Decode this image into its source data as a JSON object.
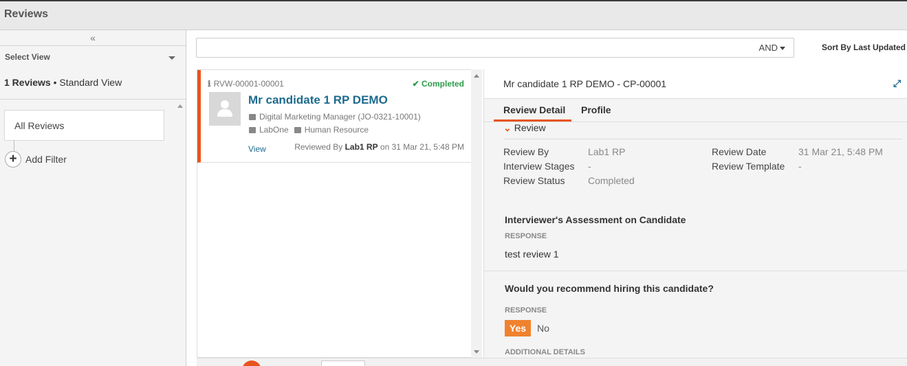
{
  "app": {
    "title": "Reviews"
  },
  "sidebar": {
    "collapse_glyph": "«",
    "select_view_label": "Select View",
    "review_count": "1 Reviews",
    "view_name": "• Standard View",
    "saved_view": "All Reviews",
    "add_filter_label": "Add Filter"
  },
  "search": {
    "value": "",
    "operator": "AND"
  },
  "sort": {
    "label": "Sort By Last Updated"
  },
  "review_card": {
    "id": "RVW-00001-00001",
    "status": "✔ Completed",
    "candidate_name": "Mr candidate 1 RP DEMO",
    "job": "Digital Marketing Manager (JO-0321-10001)",
    "company": "LabOne",
    "department": "Human Resource",
    "view_link": "View",
    "reviewed_by_prefix": "Reviewed By",
    "reviewer": "Lab1 RP",
    "reviewed_on": "on 31 Mar 21, 5:48 PM"
  },
  "detail": {
    "title": "Mr candidate 1 RP DEMO - CP-00001",
    "tabs": [
      "Review Detail",
      "Profile"
    ],
    "section": "Review",
    "fields": {
      "review_by": {
        "label": "Review By",
        "value": "Lab1 RP"
      },
      "interview_stages": {
        "label": "Interview Stages",
        "value": "-"
      },
      "review_status": {
        "label": "Review Status",
        "value": "Completed"
      },
      "review_date": {
        "label": "Review Date",
        "value": "31 Mar 21, 5:48 PM"
      },
      "review_template": {
        "label": "Review Template",
        "value": "-"
      }
    },
    "assessment": {
      "question": "Interviewer's Assessment on Candidate",
      "response_label": "RESPONSE",
      "response": "test review 1"
    },
    "recommend": {
      "question": "Would you recommend hiring this candidate?",
      "response_label": "RESPONSE",
      "yes_label": "Yes",
      "no_label": "No",
      "selected": "Yes",
      "additional_label": "ADDITIONAL DETAILS"
    }
  },
  "colors": {
    "accent": "#e8541c",
    "link": "#1e6a8d",
    "success": "#2d9b48",
    "yes_button": "#f0822e"
  }
}
